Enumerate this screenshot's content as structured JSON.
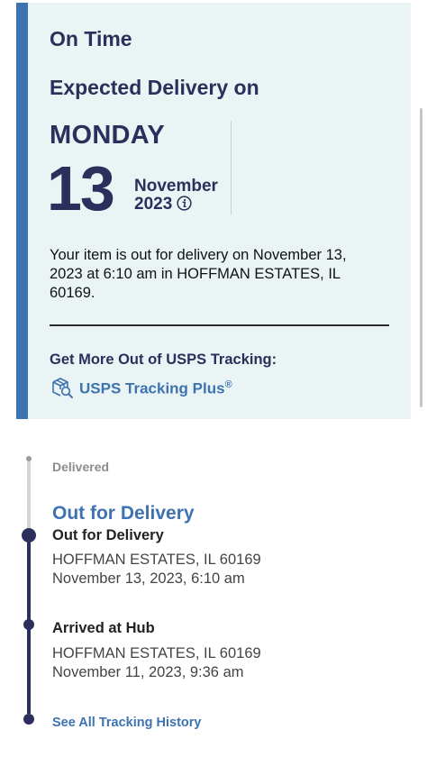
{
  "status_card": {
    "status": "On Time",
    "expected_label": "Expected Delivery on",
    "day": "MONDAY",
    "date": "13",
    "month": "November",
    "year": "2023",
    "message": "Your item is out for delivery on November 13, 2023 at 6:10 am in HOFFMAN ESTATES, IL 60169.",
    "get_more_label": "Get More Out of USPS Tracking:",
    "tracking_plus_link": "USPS Tracking Plus",
    "tracking_plus_mark": "®"
  },
  "timeline": {
    "delivered_label": "Delivered",
    "current_status": "Out for Delivery",
    "events": [
      {
        "title": "Out for Delivery",
        "location": "HOFFMAN ESTATES, IL 60169",
        "datetime": "November 13, 2023, 6:10 am"
      },
      {
        "title": "Arrived at Hub",
        "location": "HOFFMAN ESTATES, IL 60169",
        "datetime": "November 11, 2023, 9:36 am"
      }
    ],
    "see_all_link": "See All Tracking History"
  },
  "colors": {
    "card_background": "#eaf4f5",
    "accent_bar": "#3c73b0",
    "navy_text": "#2b2f5b",
    "link_blue": "#3c73b0",
    "muted_grey": "#8c8c8c"
  },
  "icons": {
    "info": "info-circle-icon",
    "tracking_plus": "package-search-icon"
  }
}
